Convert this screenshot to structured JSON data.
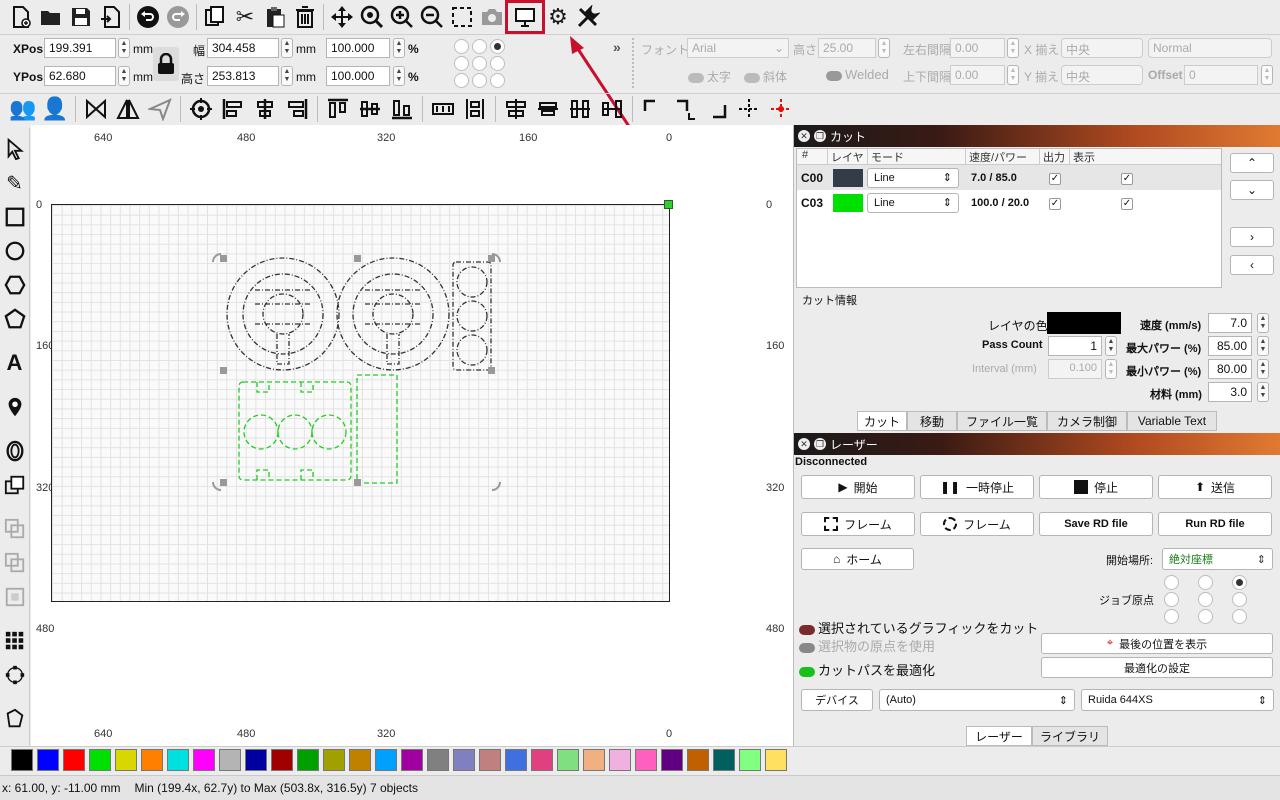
{
  "toolbar1": {
    "icons": [
      "new-file-icon",
      "open-folder-icon",
      "save-icon",
      "import-icon",
      "undo-icon",
      "redo-icon",
      "copy-icon",
      "cut-icon",
      "paste-icon",
      "delete-icon",
      "move-icon",
      "zoom-fit-icon",
      "zoom-in-icon",
      "zoom-out-icon",
      "selection-frame-icon",
      "camera-icon",
      "monitor-icon",
      "settings-gear-icon",
      "tools-wrench-icon"
    ]
  },
  "props": {
    "xpos_label": "XPos",
    "xpos_value": "199.391",
    "xpos_unit": "mm",
    "ypos_label": "YPos",
    "ypos_value": "62.680",
    "ypos_unit": "mm",
    "width_label": "幅",
    "width_value": "304.458",
    "width_unit": "mm",
    "height_label": "高さ",
    "height_value": "253.813",
    "height_unit": "mm",
    "scale_x": "100.000",
    "scale_y": "100.000",
    "percent": "%",
    "font_label": "フォント",
    "font_value": "Arial",
    "text_height_label": "高さ",
    "text_height_value": "25.00",
    "hspace_label": "左右間隔",
    "hspace_value": "0.00",
    "vspace_label": "上下間隔",
    "vspace_value": "0.00",
    "xalign_label": "X 揃え",
    "xalign_value": "中央",
    "yalign_label": "Y 揃え",
    "yalign_value": "中央",
    "normal_value": "Normal",
    "offset_label": "Offset",
    "offset_value": "0",
    "bold_label": "太字",
    "italic_label": "斜体",
    "welded_label": "Welded",
    "more_label": "»"
  },
  "canvas": {
    "top_ruler": [
      "640",
      "480",
      "320",
      "160",
      "0"
    ],
    "bottom_ruler": [
      "640",
      "480",
      "320",
      "0"
    ],
    "left_ruler": [
      "0",
      "160",
      "320",
      "480"
    ],
    "right_ruler": [
      "0",
      "160",
      "320",
      "480"
    ]
  },
  "cut_panel": {
    "title": "カット",
    "headers": [
      "#",
      "レイヤ",
      "モード",
      "速度/パワー",
      "出力",
      "表示"
    ],
    "rows": [
      {
        "id": "C00",
        "color": "#333c48",
        "mode": "Line",
        "speed_power": "7.0 / 85.0",
        "output": "✓",
        "show": "✓"
      },
      {
        "id": "C03",
        "color": "#00e000",
        "mode": "Line",
        "speed_power": "100.0 / 20.0",
        "output": "✓",
        "show": "✓"
      }
    ],
    "info_title": "カット情報",
    "layer_color_label": "レイヤの色",
    "layer_color": "#000000",
    "pass_count_label": "Pass Count",
    "pass_count_value": "1",
    "interval_label": "Interval (mm)",
    "interval_value": "0.100",
    "speed_label": "速度 (mm/s)",
    "speed_value": "7.0",
    "max_power_label": "最大パワー (%)",
    "max_power_value": "85.00",
    "min_power_label": "最小パワー (%)",
    "min_power_value": "80.00",
    "material_label": "材料 (mm)",
    "material_value": "3.0",
    "tabs": [
      "カット",
      "移動",
      "ファイル一覧",
      "カメラ制御",
      "Variable Text"
    ]
  },
  "laser_panel": {
    "title": "レーザー",
    "status": "Disconnected",
    "start": "開始",
    "pause": "一時停止",
    "stop": "停止",
    "send": "送信",
    "frame1": "フレーム",
    "frame2": "フレーム",
    "save_rd": "Save RD file",
    "run_rd": "Run RD file",
    "home": "ホーム",
    "start_from_label": "開始場所:",
    "start_from_value": "絶対座標",
    "job_origin_label": "ジョブ原点",
    "cut_selected": "選択されているグラフィックをカット",
    "use_selection_origin": "選択物の原点を使用",
    "optimize_cut": "カットパスを最適化",
    "show_last_position": "最後の位置を表示",
    "optimize_settings": "最適化の設定",
    "device_label": "デバイス",
    "device_port": "(Auto)",
    "device_model": "Ruida 644XS",
    "tabs": [
      "レーザー",
      "ライブラリ"
    ]
  },
  "palette": [
    "#000000",
    "#0000ff",
    "#ff0000",
    "#00e000",
    "#d8d800",
    "#ff8000",
    "#00e0e0",
    "#ff00ff",
    "#b4b4b4",
    "#0000a0",
    "#a00000",
    "#00a000",
    "#a0a000",
    "#c08000",
    "#00a0ff",
    "#a000a0",
    "#808080",
    "#8080c0",
    "#c08080",
    "#4070e0",
    "#e04080",
    "#80e080",
    "#f0b080",
    "#f0b0e0",
    "#ff60c0",
    "#600080",
    "#c06000",
    "#006060",
    "#80ff80",
    "#ffe060"
  ],
  "status_bar": {
    "coords": "x: 61.00, y: -11.00 mm",
    "bounds": "Min (199.4x, 62.7y) to Max (503.8x, 316.5y)  7 objects"
  },
  "colors": {
    "accent": "#c8102e",
    "selected_row": "#e6e6e6"
  }
}
